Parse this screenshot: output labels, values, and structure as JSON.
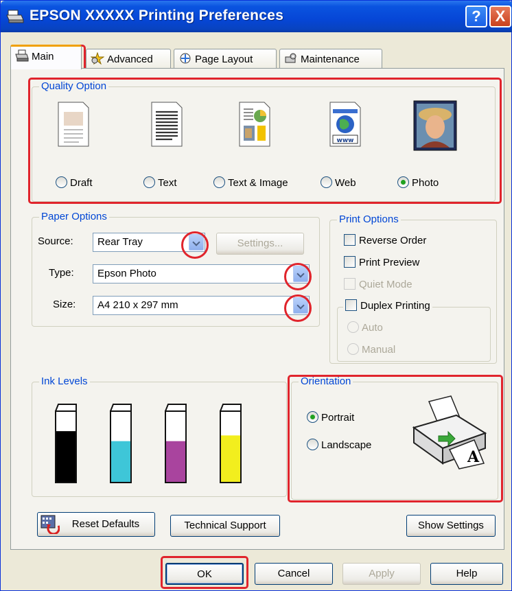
{
  "window": {
    "title": "EPSON  XXXXX  Printing Preferences",
    "help_glyph": "?",
    "close_glyph": "X"
  },
  "tabs": [
    {
      "label": "Main",
      "icon": "printer-icon"
    },
    {
      "label": "Advanced",
      "icon": "star-settings-icon"
    },
    {
      "label": "Page Layout",
      "icon": "layout-icon"
    },
    {
      "label": "Maintenance",
      "icon": "maintenance-icon"
    }
  ],
  "quality": {
    "legend": "Quality Option",
    "options": [
      {
        "label": "Draft",
        "selected": false
      },
      {
        "label": "Text",
        "selected": false
      },
      {
        "label": "Text & Image",
        "selected": false
      },
      {
        "label": "Web",
        "selected": false
      },
      {
        "label": "Photo",
        "selected": true
      }
    ]
  },
  "paper": {
    "legend": "Paper Options",
    "source_label": "Source:",
    "source_value": "Rear Tray",
    "settings_button": "Settings...",
    "type_label": "Type:",
    "type_value": "Epson Photo",
    "size_label": "Size:",
    "size_value": "A4 210 x 297 mm"
  },
  "print_options": {
    "legend": "Print Options",
    "reverse_order": "Reverse Order",
    "print_preview": "Print Preview",
    "quiet_mode": "Quiet Mode",
    "duplex": "Duplex Printing",
    "auto": "Auto",
    "manual": "Manual"
  },
  "ink": {
    "legend": "Ink Levels",
    "colors": [
      "#000000",
      "#3ec6d8",
      "#a9449e",
      "#f2ee1e"
    ],
    "levels": [
      0.72,
      0.58,
      0.58,
      0.66
    ]
  },
  "orientation": {
    "legend": "Orientation",
    "portrait": "Portrait",
    "landscape": "Landscape",
    "selected": "Portrait"
  },
  "bottom": {
    "reset_defaults": "Reset Defaults",
    "technical_support": "Technical Support",
    "show_settings": "Show Settings",
    "ok": "OK",
    "cancel": "Cancel",
    "apply": "Apply",
    "help": "Help"
  },
  "colors": {
    "highlight": "#e0242c",
    "titlebar": "#0a54e0",
    "group_legend": "#0046d5",
    "radio_dot": "#21a121"
  }
}
